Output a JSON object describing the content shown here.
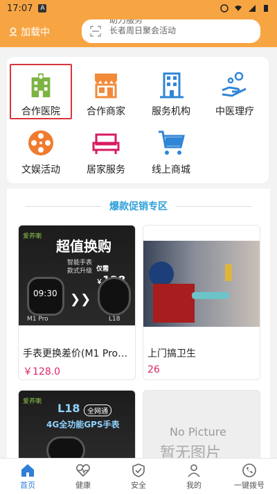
{
  "status_bar": {
    "time": "17:07",
    "a_badge": "A"
  },
  "header": {
    "location_label": "加载中",
    "notice_line_1": "助力服务",
    "notice_line_2": "长者周日聚会活动"
  },
  "services": [
    {
      "label": "合作医院",
      "icon": "hospital-icon"
    },
    {
      "label": "合作商家",
      "icon": "shop-icon"
    },
    {
      "label": "服务机构",
      "icon": "building-icon"
    },
    {
      "label": "中医理疗",
      "icon": "care-hand-icon"
    },
    {
      "label": "文娱活动",
      "icon": "film-reel-icon"
    },
    {
      "label": "居家服务",
      "icon": "sofa-icon"
    },
    {
      "label": "线上商城",
      "icon": "cart-icon"
    }
  ],
  "promo": {
    "title": "爆款促销专区"
  },
  "products": [
    {
      "name": "手表更换差价(M1 Pro…",
      "price": "￥128.0",
      "banner": {
        "brand": "爱养喇",
        "title": "超值换购",
        "sub_1": "智能手表",
        "sub_2": "款式升级",
        "price_prefix": "仅需￥",
        "price": "128",
        "label_left": "M1 Pro",
        "label_right": "L18",
        "watch_time": "09:30"
      }
    },
    {
      "name": "上门搞卫生",
      "price": "26"
    },
    {
      "banner": {
        "brand": "爱养喇",
        "title": "L18",
        "badge": "全网通",
        "sub": "4G全功能GPS手表"
      }
    },
    {
      "no_picture": "No Picture",
      "no_picture_cn": "暂无图片"
    }
  ],
  "bottom_nav": [
    {
      "label": "首页",
      "icon": "home-icon",
      "active": true
    },
    {
      "label": "健康",
      "icon": "heart-pulse-icon"
    },
    {
      "label": "安全",
      "icon": "shield-check-icon"
    },
    {
      "label": "我的",
      "icon": "user-icon"
    },
    {
      "label": "一键拨号",
      "icon": "phone-icon"
    }
  ],
  "colors": {
    "accent": "#f7a543",
    "promo": "#2fa0d8",
    "price": "#d9266a",
    "selected_border": "#d6353a",
    "nav_active": "#2f7ed8"
  }
}
